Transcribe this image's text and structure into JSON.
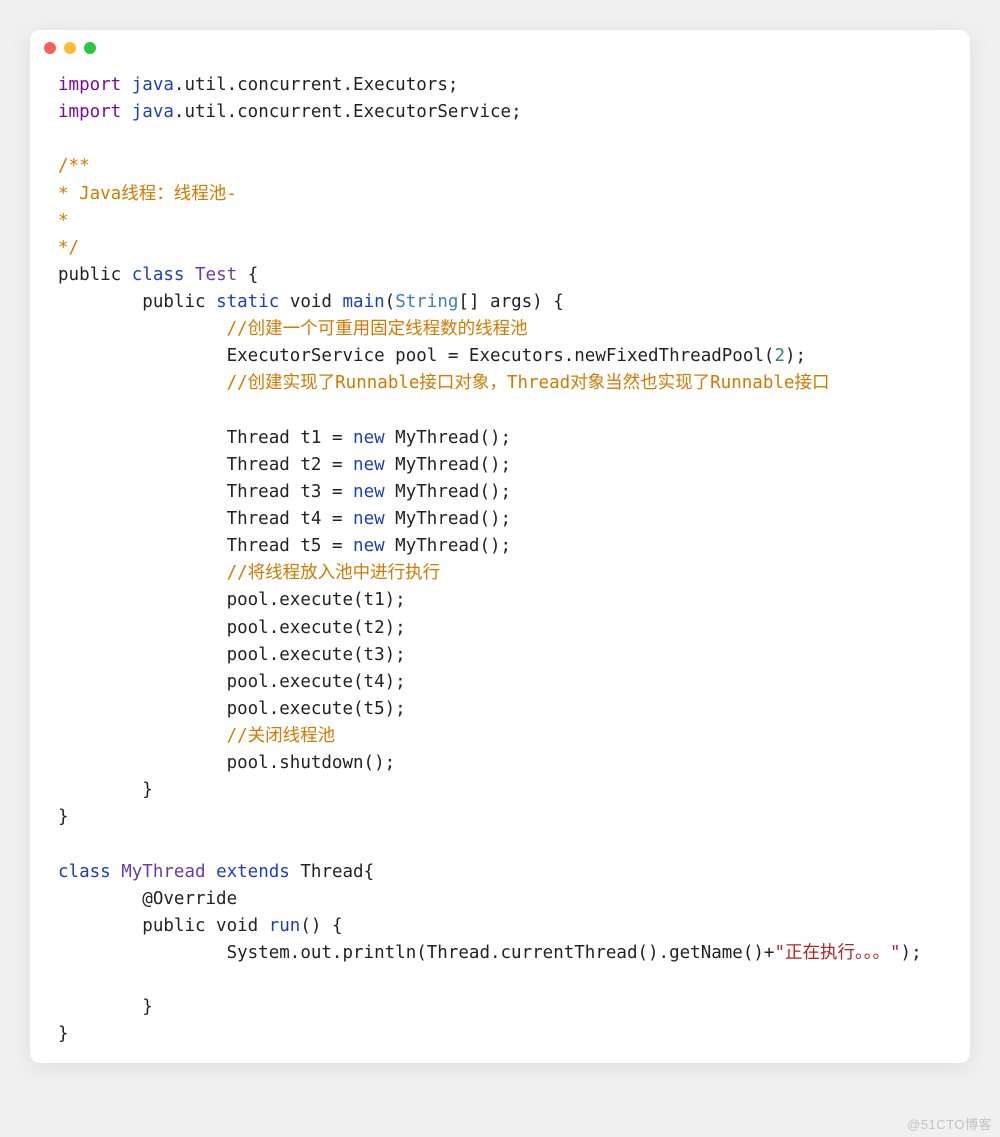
{
  "watermark": "@51CTO博客",
  "code": {
    "import_kw": "import",
    "pkg1_head": "java",
    "pkg1_tail": ".util.concurrent.Executors;",
    "pkg2_head": "java",
    "pkg2_tail": ".util.concurrent.ExecutorService;",
    "doc1": "/**",
    "doc2": "* Java线程：线程池-",
    "doc3": "*",
    "doc4": "*/",
    "public_kw": "public",
    "class_kw": "class",
    "test_ident": "Test",
    "lbrace": " {",
    "static_kw": "static",
    "void_kw": " void ",
    "main_fn": "main",
    "lparen": "(",
    "string_type": "String",
    "args_tail": "[] args) {",
    "cm_pool_create": "//创建一个可重用固定线程数的线程池",
    "exec_line_head": "ExecutorService pool = Executors.newFixedThreadPool(",
    "exec_num": "2",
    "exec_line_tail": ");",
    "cm_runnable": "//创建实现了Runnable接口对象，Thread对象当然也实现了Runnable接口",
    "t_decl_head": "Thread t",
    "eq_new": " = ",
    "new_kw": "new",
    "mythread_tail": " MyThread();",
    "t1": "1",
    "t2": "2",
    "t3": "3",
    "t4": "4",
    "t5": "5",
    "cm_put": "//将线程放入池中进行执行",
    "exec1": "pool.execute(t1);",
    "exec2": "pool.execute(t2);",
    "exec3": "pool.execute(t3);",
    "exec4": "pool.execute(t4);",
    "exec5": "pool.execute(t5);",
    "cm_close": "//关闭线程池",
    "shutdown": "pool.shutdown();",
    "rbrace": "}",
    "mythread_ident": "MyThread",
    "extends_kw": "extends",
    "thread_tail": " Thread{",
    "override": "@Override",
    "run_fn": "run",
    "run_tail": "() {",
    "println_head": "System.out.println(Thread.currentThread().getName()+",
    "println_str": "\"正在执行。。。\"",
    "println_tail": ");"
  }
}
